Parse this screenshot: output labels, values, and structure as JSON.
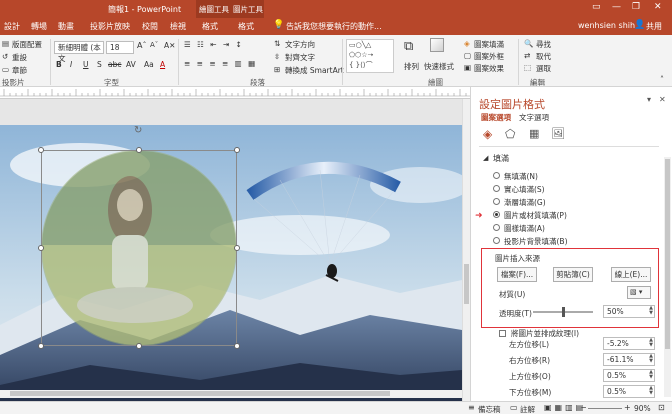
{
  "title_bar": {
    "doc_title": "簡報1 - PowerPoint",
    "context_group_1": "繪圖工具",
    "context_group_2": "圖片工具",
    "window_controls": [
      "minimize-icon",
      "restore-icon",
      "close-icon"
    ]
  },
  "tabs": [
    "設計",
    "轉場",
    "動畫",
    "投影片放映",
    "校閱",
    "檢視",
    "格式",
    "格式"
  ],
  "tell_me": "告訴我您想要執行的動作...",
  "user": {
    "name": "wenhsien shih",
    "share": "共用"
  },
  "ribbon": {
    "slides_group": {
      "new_slide": "版面配置",
      "reset": "重設",
      "section": "章節",
      "label": "投影片"
    },
    "font": {
      "name": "新細明體 (本文",
      "size": "18",
      "label": "字型",
      "format_buttons": [
        "B",
        "I",
        "U",
        "S",
        "abc",
        "AV",
        "Aa",
        "A"
      ]
    },
    "paragraph": {
      "text_direction": "文字方向",
      "align_text": "對齊文字",
      "smartart": "轉換成 SmartArt",
      "label": "段落"
    },
    "drawing": {
      "arrange": "排列",
      "quick_styles": "快速樣式",
      "fill": "圖案填滿",
      "outline": "圖案外框",
      "effects": "圖案效果",
      "label": "繪圖"
    },
    "editing": {
      "find": "尋找",
      "replace": "取代",
      "select": "選取",
      "label": "編輯"
    }
  },
  "format_pane": {
    "title": "設定圖片格式",
    "subtabs": [
      "圖案選項",
      "文字選項"
    ],
    "section": "填滿",
    "fill_options": [
      {
        "label": "無填滿(N)",
        "selected": false
      },
      {
        "label": "實心填滿(S)",
        "selected": false
      },
      {
        "label": "漸層填滿(G)",
        "selected": false
      },
      {
        "label": "圖片或材質填滿(P)",
        "selected": true
      },
      {
        "label": "圖樣填滿(A)",
        "selected": false
      },
      {
        "label": "投影片背景填滿(B)",
        "selected": false
      }
    ],
    "source_label": "圖片插入來源",
    "file_btn": "檔案(F)...",
    "clipboard_btn": "剪貼簿(C)",
    "online_btn": "線上(E)...",
    "texture_label": "材質(U)",
    "transparency_label": "透明度(T)",
    "transparency_value": "50%",
    "transparency_fraction": 0.5,
    "tile_label": "將圖片並排成紋理(I)",
    "offsets": [
      {
        "label": "左方位移(L)",
        "value": "-5.2%"
      },
      {
        "label": "右方位移(R)",
        "value": "-61.1%"
      },
      {
        "label": "上方位移(O)",
        "value": "0.5%"
      },
      {
        "label": "下方位移(M)",
        "value": "0.5%"
      }
    ]
  },
  "status": {
    "notes": "備忘稿",
    "comments": "註解",
    "zoom": "90%"
  },
  "colors": {
    "accent": "#b7472a",
    "highlight_box": "#e0343a"
  }
}
